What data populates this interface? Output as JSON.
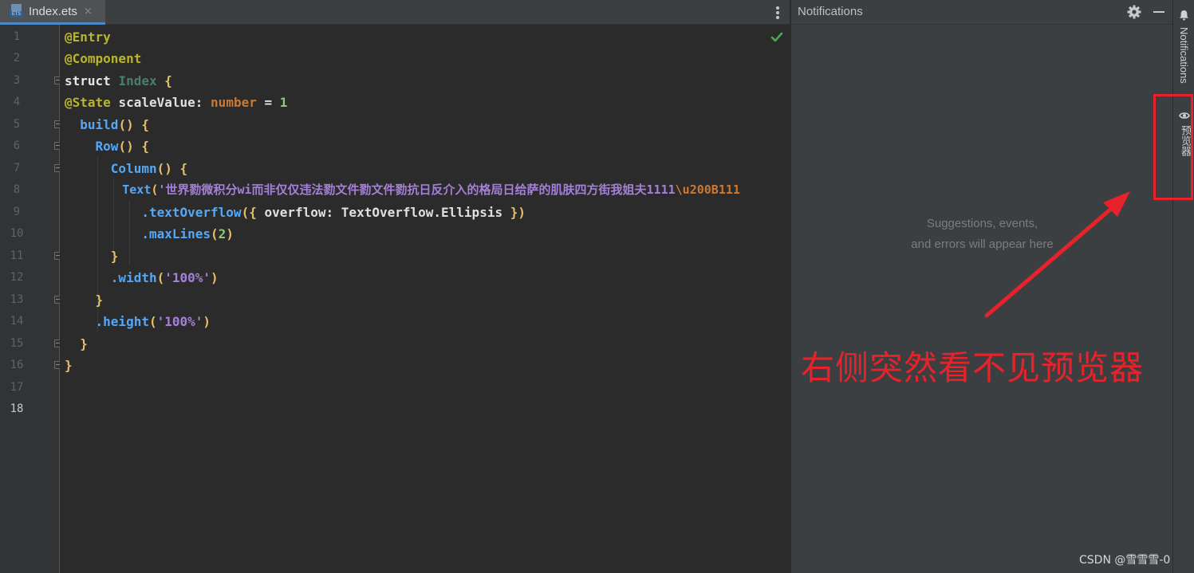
{
  "editor": {
    "tab": {
      "file_name": "Index.ets",
      "icon": "ets-file-icon",
      "close": "×"
    },
    "current_line": 18,
    "line_numbers": [
      "1",
      "2",
      "3",
      "4",
      "5",
      "6",
      "7",
      "8",
      "9",
      "10",
      "11",
      "12",
      "13",
      "14",
      "15",
      "16",
      "17",
      "18"
    ],
    "code": {
      "l1": "@Entry",
      "l2": "@Component",
      "l3_kw": "struct",
      "l3_name": "Index",
      "l3_brace": "{",
      "l4_anno": "@State",
      "l4_name": "scaleValue",
      "l4_colon": ":",
      "l4_type": "number",
      "l4_eq": "=",
      "l4_val": "1",
      "l5_fn": "build",
      "l5_rest": "() {",
      "l6_fn": "Row",
      "l6_rest": "() {",
      "l7_fn": "Column",
      "l7_rest": "() {",
      "l8_fn": "Text",
      "l8_open": "(",
      "l8_str": "'世界勠微积分wi而非仅仅违法勠文件勠文件勠抗日反介入的格局日给萨的肌肤四方街我姐夫1111",
      "l8_esc": "\\u200B111",
      "l9_method": ".textOverflow",
      "l9_open": "({ ",
      "l9_key": "overflow",
      "l9_colon": ": ",
      "l9_val": "TextOverflow.Ellipsis",
      "l9_close": " })",
      "l10_method": ".maxLines",
      "l10_open": "(",
      "l10_val": "2",
      "l10_close": ")",
      "l11": "}",
      "l12_method": ".width",
      "l12_open": "(",
      "l12_str": "'100%'",
      "l12_close": ")",
      "l13": "}",
      "l14_method": ".height",
      "l14_open": "(",
      "l14_str": "'100%'",
      "l14_close": ")",
      "l15": "}",
      "l16": "}"
    },
    "status_icon": "checkmark-icon"
  },
  "notifications": {
    "title": "Notifications",
    "empty_line1": "Suggestions, events,",
    "empty_line2": "and errors will appear here"
  },
  "tool_strip": {
    "notifications_label": "Notifications",
    "preview_label": "预览器"
  },
  "annotation": {
    "text": "右侧突然看不见预览器",
    "color": "#e8222a"
  },
  "watermark": "CSDN @雪雪雪-0",
  "colors": {
    "annotation": "#e8222a",
    "tab_underline": "#4a88c7",
    "check": "#4eaa4e"
  }
}
